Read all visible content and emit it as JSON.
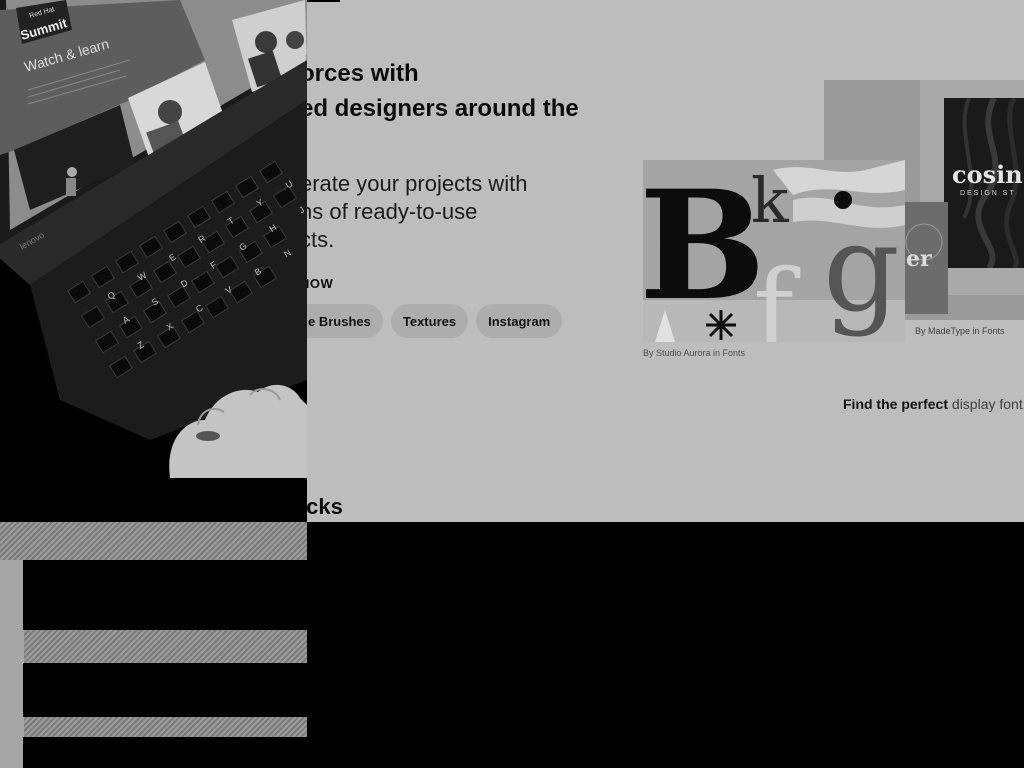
{
  "hero": {
    "heading_lines": [
      "orces with",
      "ed designers around the",
      "."
    ],
    "sub_lines": [
      "erate your projects with",
      "ns of ready-to-use",
      "cts."
    ],
    "cta": "NOW"
  },
  "chips": [
    {
      "label": "e Brushes"
    },
    {
      "label": "Textures"
    },
    {
      "label": "Instagram"
    }
  ],
  "showcase": {
    "left_caption": "By Studio Aurora in Fonts",
    "right_caption": "By MadeType in Fonts",
    "cosine_text": "cosin",
    "cosine_sub": "DESIGN ST",
    "er_text": "er",
    "type_letters": "Bk'g",
    "find_bold": "Find the perfect",
    "find_link": "display font"
  },
  "photo": {
    "summit_brand": "Red Hat",
    "summit_title": "Summit",
    "summit_tagline": "Watch & learn",
    "laptop_brand": "lenovo",
    "row_top": "Q W E R T Y U",
    "row_mid": "A S D F G H J",
    "row_low": "Z X C V B N"
  },
  "section_title": "icks",
  "colors": {
    "page_bg": "#bdbdbd",
    "chip_bg": "#adadad",
    "text": "#0b0b0b"
  }
}
